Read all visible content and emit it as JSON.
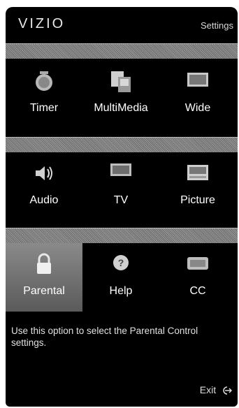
{
  "header": {
    "brand": "VIZIO",
    "section": "Settings"
  },
  "menu": {
    "row1": [
      {
        "label": "Timer",
        "icon": "timer-icon"
      },
      {
        "label": "MultiMedia",
        "icon": "multimedia-icon"
      },
      {
        "label": "Wide",
        "icon": "wide-icon"
      }
    ],
    "row2": [
      {
        "label": "Audio",
        "icon": "audio-icon"
      },
      {
        "label": "TV",
        "icon": "tv-icon"
      },
      {
        "label": "Picture",
        "icon": "picture-icon"
      }
    ],
    "row3": [
      {
        "label": "Parental",
        "icon": "lock-icon",
        "selected": true
      },
      {
        "label": "Help",
        "icon": "help-icon"
      },
      {
        "label": "CC",
        "icon": "closed-caption-icon"
      }
    ]
  },
  "help_text": "Use this option to select the Parental Control settings.",
  "footer": {
    "exit_label": "Exit",
    "exit_icon": "exit-icon"
  },
  "colors": {
    "background": "#000000",
    "band": "#8a8a8a",
    "selected": "#777777",
    "text": "#ffffff"
  }
}
